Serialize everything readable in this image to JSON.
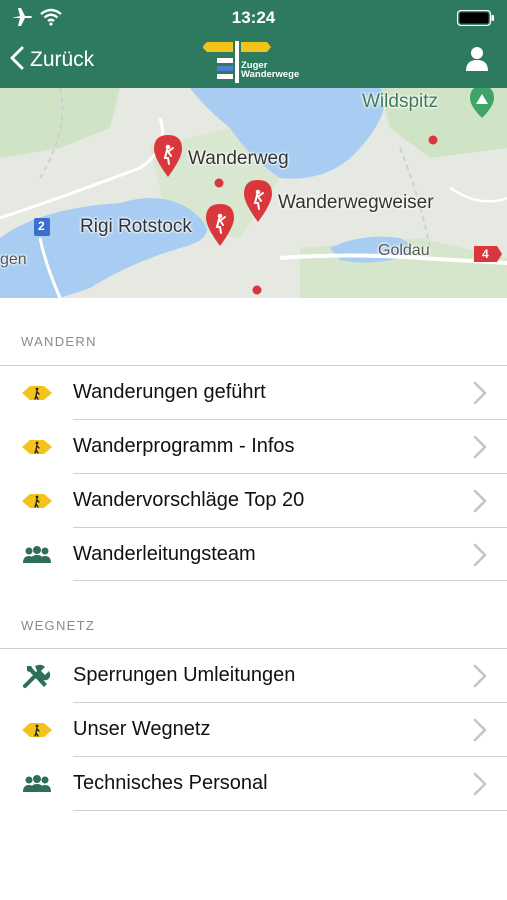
{
  "status_bar": {
    "time": "13:24"
  },
  "nav": {
    "back_label": "Zurück",
    "logo_line1": "Zuger",
    "logo_line2": "Wanderwege"
  },
  "map": {
    "labels": {
      "wildspitz": "Wildspitz",
      "wanderweg": "Wanderweg",
      "wanderwegweiser": "Wanderwegweiser",
      "rigi_rotstock": "Rigi Rotstock",
      "goldau": "Goldau",
      "gen": "gen",
      "road_2": "2",
      "road_4": "4"
    }
  },
  "sections": [
    {
      "title": "WANDERN",
      "items": [
        {
          "label": "Wanderungen geführt",
          "icon": "hiker-sign-icon"
        },
        {
          "label": "Wanderprogramm - Infos",
          "icon": "hiker-sign-icon"
        },
        {
          "label": "Wandervorschläge Top 20",
          "icon": "hiker-sign-icon"
        },
        {
          "label": "Wanderleitungsteam",
          "icon": "group-icon"
        }
      ]
    },
    {
      "title": "WEGNETZ",
      "items": [
        {
          "label": "Sperrungen Umleitungen",
          "icon": "tools-icon"
        },
        {
          "label": "Unser Wegnetz",
          "icon": "hiker-sign-icon"
        },
        {
          "label": "Technisches Personal",
          "icon": "group-icon"
        }
      ]
    }
  ],
  "colors": {
    "nav_green": "#2d7a5f",
    "sign_yellow": "#f3c21b",
    "icon_green": "#2f6e57",
    "pin_red": "#d9373c"
  }
}
